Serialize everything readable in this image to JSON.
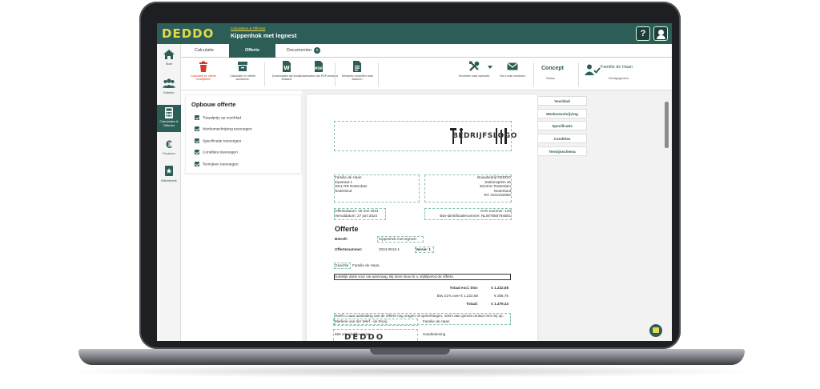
{
  "app": {
    "logo": "DEDDO",
    "breadcrumb": "Calculaties & Offertes",
    "title": "Kippenhok met legnest",
    "help": "?"
  },
  "nav": [
    {
      "label": "Start",
      "icon": "home-icon"
    },
    {
      "label": "Klanten",
      "icon": "users-icon"
    },
    {
      "label": "Calculaties & Offertes",
      "icon": "calculator-icon"
    },
    {
      "label": "Facturen",
      "icon": "euro-icon"
    },
    {
      "label": "Bibliotheek",
      "icon": "book-icon"
    }
  ],
  "tabs": [
    {
      "label": "Calculatie"
    },
    {
      "label": "Offerte"
    },
    {
      "label": "Documenten",
      "count": "0"
    }
  ],
  "toolbar": {
    "delete": "Calculatie en offerte verwijderen",
    "archive": "Calculatie en offerte archiveren",
    "word": "Downloaden als Word-bestand",
    "pdf": "Downloaden als PDF-bestand",
    "terms": "Termijnen omzetten naar facturen",
    "convert": "Omzetten naar opdracht",
    "email": "Via e-mail versturen",
    "status": "Concept",
    "status_sub": "Status",
    "customer": "Familie de Haan",
    "customer_sub": "Klantgegevens"
  },
  "panel": {
    "title": "Opbouw offerte",
    "options": [
      "Totaalprijs op voorblad",
      "Werkomschrijving toevoegen",
      "Specificatie toevoegen",
      "Condities toevoegen",
      "Termijnen toevoegen"
    ]
  },
  "sections": [
    "Voorblad",
    "Werkomschrijving",
    "Specificatie",
    "Condities",
    "Termijnschema"
  ],
  "document": {
    "logo": "BEDRIJFSLOGO",
    "client": [
      "Familie de Haan",
      "Kipstraat 1",
      "3011 RR Rotterdam",
      "Nederland"
    ],
    "company": [
      "Bouwbedrijf DEDDO",
      "Stationsplein 45",
      "3013AK Rotterdam",
      "Nederland",
      "Tel: 0102232852"
    ],
    "date_line": "Offertedatum: 28 mei 2024",
    "expiry_line": "Vervaldatum: 27 juni 2024",
    "kvk_line": "KVK-nummer: 123",
    "vat_line": "Btw-identificatienummer: NL007655794B01",
    "heading": "Offerte",
    "subject_label": "Betreft:",
    "subject": "Kippenhok met legnest",
    "number_label": "Offertenummer:",
    "number": "2024-0013-1",
    "version": "Versie: 1",
    "salutation_a": "Geachte",
    "salutation_b": "Familie de Haan,",
    "intro": "Hartelijk dank voor uw aanvraag. Bij deze stuur ik u vrijblijvend de offerte.",
    "total_excl_label": "Totaal excl. btw:",
    "total_excl": "€ 1.222,68",
    "vat_label": "Btw 21% over € 1.222,68",
    "vat": "€ 256,75",
    "total_label": "Totaal:",
    "total": "€ 1.479,43",
    "closing": "Heeft u naar aanleiding van de offerte nog vragen of opmerkingen, neem dan gerust contact met mij op.",
    "greeting": "Met vriendelijke groet,",
    "signer": "Marlene van der Werf - de Rooij",
    "recipient": "Familie de Haan",
    "signature_label": "Handtekening",
    "sig_logo": "DEDDO"
  }
}
